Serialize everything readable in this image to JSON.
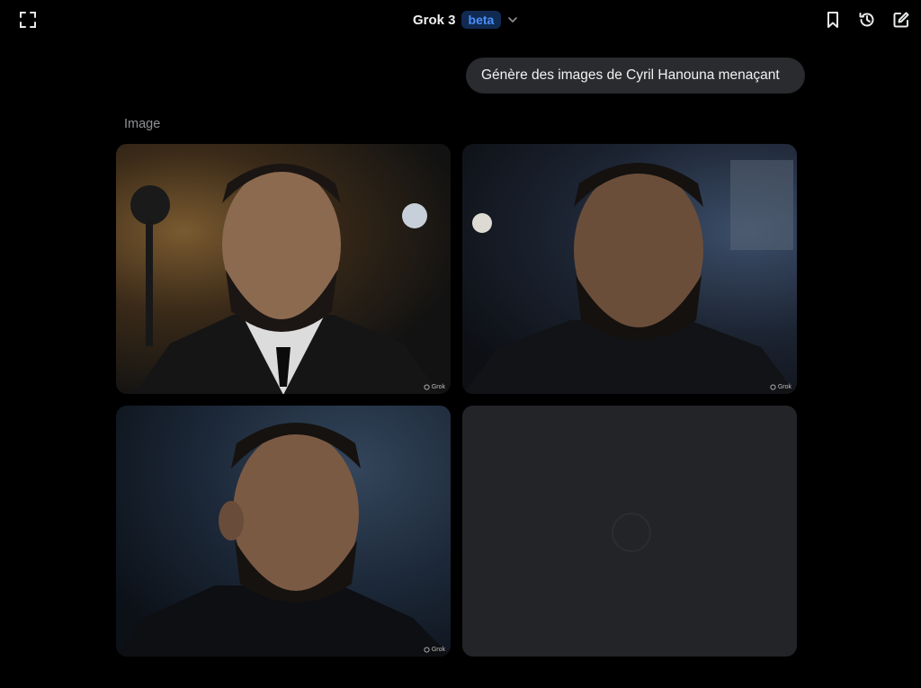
{
  "header": {
    "model_name": "Grok 3",
    "badge": "beta"
  },
  "icons": {
    "expand": "expand-icon",
    "model_chevron": "chevron-down-icon",
    "bookmark": "bookmark-icon",
    "history": "history-icon",
    "compose": "compose-icon"
  },
  "conversation": {
    "user_message": "Génère des images de Cyril Hanouna menaçant",
    "response_label": "Image"
  },
  "images": [
    {
      "watermark": "Grok",
      "status": "loaded"
    },
    {
      "watermark": "Grok",
      "status": "loaded"
    },
    {
      "watermark": "Grok",
      "status": "loaded"
    },
    {
      "watermark": "",
      "status": "loading"
    }
  ],
  "colors": {
    "background": "#000000",
    "bubble": "#2a2b2f",
    "badge_bg": "#102a52",
    "badge_text": "#4c8ef7",
    "placeholder": "#232428"
  }
}
